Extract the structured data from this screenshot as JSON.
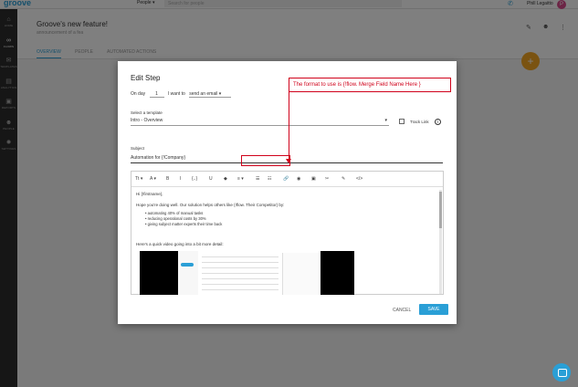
{
  "topbar": {
    "logo": "groove",
    "people_dropdown": "People ▾",
    "search_placeholder": "Search for people",
    "user_name": "Phill Legaitto",
    "avatar_initial": "P"
  },
  "sidebar": {
    "items": [
      {
        "icon": "home-icon",
        "glyph": "⌂",
        "label": "HOME"
      },
      {
        "icon": "flows-icon",
        "glyph": "∞",
        "label": "FLOWS"
      },
      {
        "icon": "templates-icon",
        "glyph": "✉",
        "label": "TEMPLATES"
      },
      {
        "icon": "analytics-icon",
        "glyph": "▤",
        "label": "ANALYTICS"
      },
      {
        "icon": "reports-icon",
        "glyph": "▣",
        "label": "REPORTS"
      },
      {
        "icon": "people-icon",
        "glyph": "☻",
        "label": "PEOPLE"
      },
      {
        "icon": "settings-icon",
        "glyph": "✹",
        "label": "SETTINGS"
      }
    ]
  },
  "page": {
    "title": "Groove's new feature!",
    "subtitle": "announcement of a fea",
    "tabs": [
      "OVERVIEW",
      "PEOPLE",
      "AUTOMATED ACTIONS"
    ],
    "fab_label": "+"
  },
  "modal": {
    "title": "Edit Step",
    "on_day_label": "On day",
    "day_value": "1",
    "want_to_label": "I want to",
    "action_value": "send an email",
    "template_label": "Select a template",
    "template_value": "Intro - Overview",
    "track_link_label": "Track Link",
    "subject_label": "Subject",
    "subject_value": "Automation for {!Company}",
    "toolbar": [
      "Tt ▾",
      "A ▾",
      "B",
      "I",
      "{..}",
      "U",
      "◆",
      "≡ ▾",
      "☰",
      "☷",
      "🔗",
      "◉",
      "▣",
      "✂",
      "✎",
      "</>"
    ],
    "body": {
      "greeting": "Hi {!firstname},",
      "line1": "Hope you're doing well. Our solution helps others like {!flow. Their Competitor} by:",
      "bullets": [
        "automating 40% of manual tasks",
        "reducing operational costs by 30%",
        "giving subject matter experts their time back"
      ],
      "line2": "Here's a quick video going into a bit more detail:"
    },
    "annotation": "The format to use is {!flow. Merge Field Name Here }",
    "cancel_label": "CANCEL",
    "save_label": "SAVE"
  },
  "colors": {
    "accent": "#2a9fd6",
    "fab": "#f5a623",
    "annotation": "#d0021b",
    "sidebar": "#2c2c2c"
  }
}
